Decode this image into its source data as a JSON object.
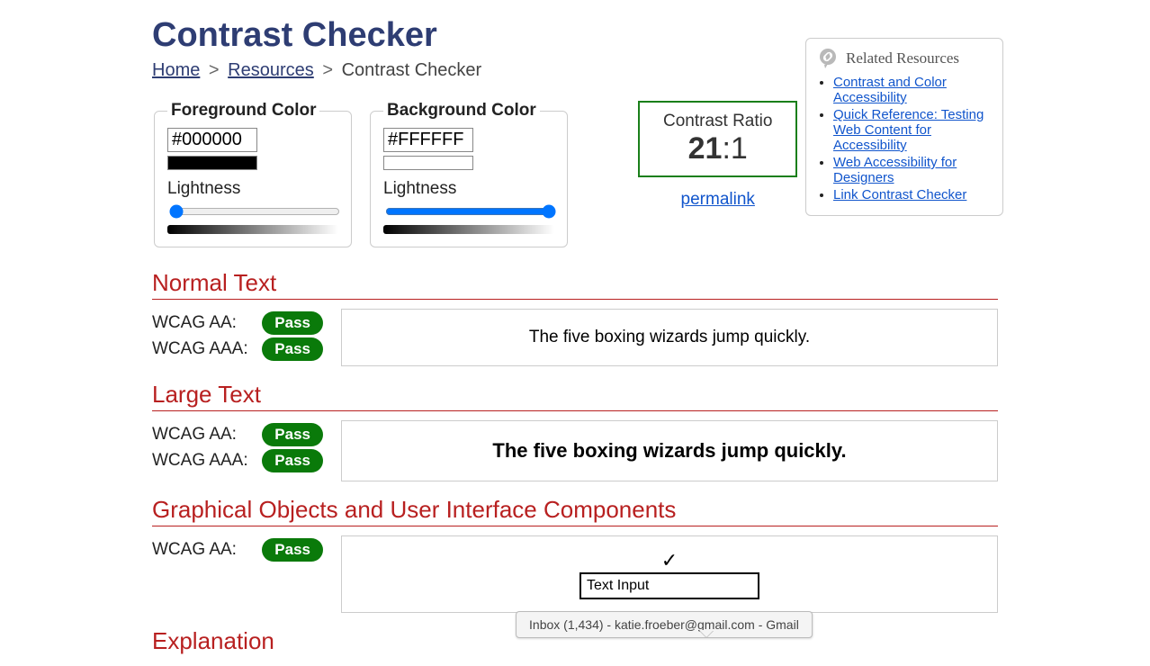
{
  "title": "Contrast Checker",
  "breadcrumb": {
    "home": "Home",
    "resources": "Resources",
    "current": "Contrast Checker"
  },
  "sidebar": {
    "title": "Related Resources",
    "items": [
      "Contrast and Color Accessibility",
      "Quick Reference: Testing Web Content for Accessibility",
      "Web Accessibility for Designers",
      "Link Contrast Checker"
    ]
  },
  "foreground": {
    "legend": "Foreground Color",
    "value": "#000000",
    "swatch": "#000000",
    "lightness_label": "Lightness",
    "lightness": 0
  },
  "background": {
    "legend": "Background Color",
    "value": "#FFFFFF",
    "swatch": "#FFFFFF",
    "lightness_label": "Lightness",
    "lightness": 100
  },
  "ratio": {
    "label": "Contrast Ratio",
    "numerator": "21",
    "denominator": ":1",
    "permalink": "permalink"
  },
  "sections": {
    "normal": {
      "heading": "Normal Text",
      "criteria": [
        {
          "label": "WCAG AA:",
          "result": "Pass"
        },
        {
          "label": "WCAG AAA:",
          "result": "Pass"
        }
      ],
      "sample": "The five boxing wizards jump quickly."
    },
    "large": {
      "heading": "Large Text",
      "criteria": [
        {
          "label": "WCAG AA:",
          "result": "Pass"
        },
        {
          "label": "WCAG AAA:",
          "result": "Pass"
        }
      ],
      "sample": "The five boxing wizards jump quickly."
    },
    "ui": {
      "heading": "Graphical Objects and User Interface Components",
      "criteria": [
        {
          "label": "WCAG AA:",
          "result": "Pass"
        }
      ],
      "check_glyph": "✓",
      "input_value": "Text Input"
    },
    "explanation_heading": "Explanation"
  },
  "tooltip": "Inbox (1,434) - katie.froeber@gmail.com - Gmail"
}
